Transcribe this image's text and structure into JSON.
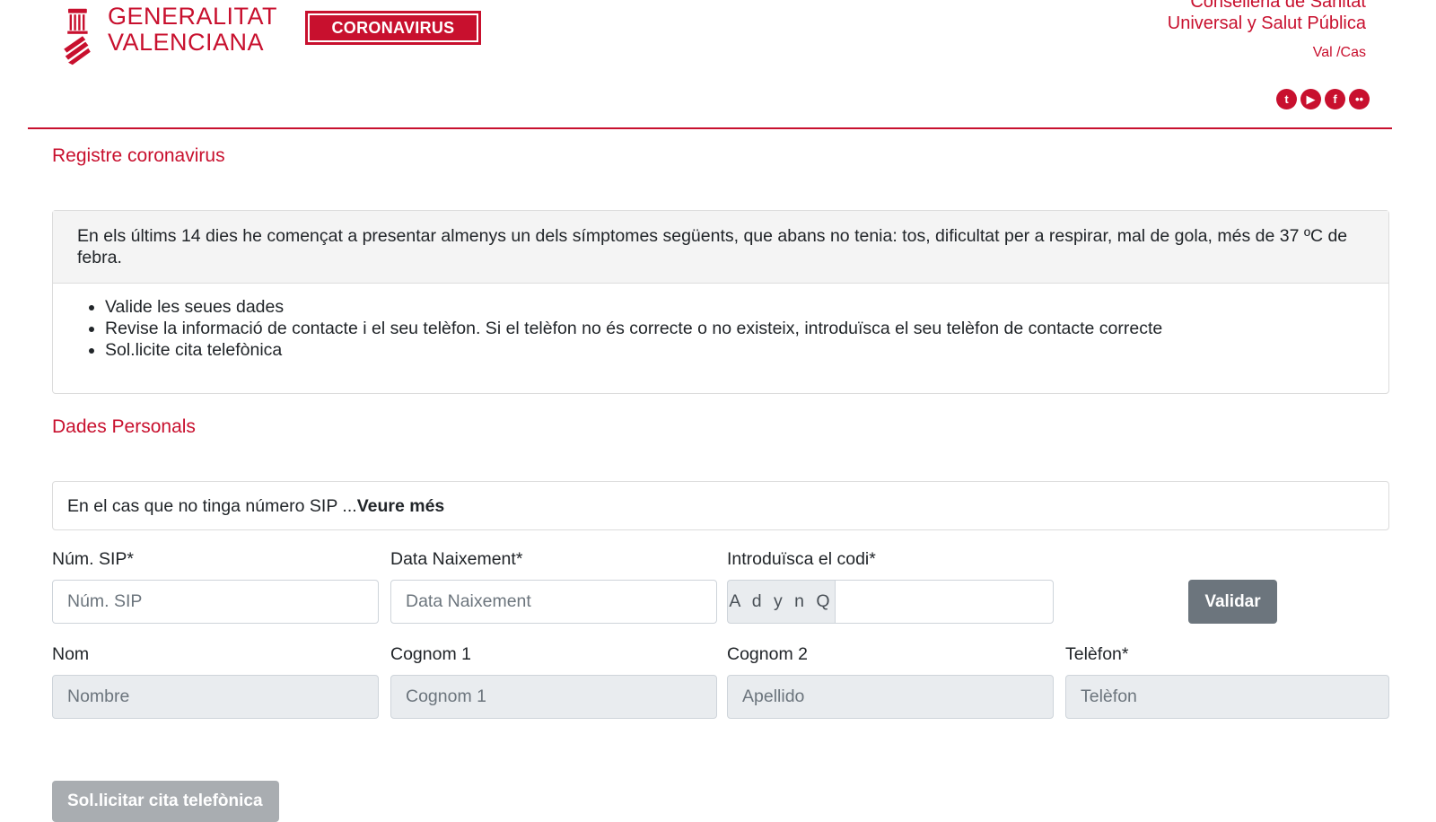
{
  "header": {
    "logo_line1": "GENERALITAT",
    "logo_line2": "VALENCIANA",
    "coronavirus_button": "CORONAVIRUS",
    "conselleria_line1": "Conselleria de Sanitat",
    "conselleria_line2": "Universal y Salut Pública",
    "language": "Val /Cas",
    "social_icons": [
      "twitter-icon",
      "youtube-icon",
      "facebook-icon",
      "flickr-icon"
    ],
    "brand_color": "#c8102e"
  },
  "page_title": "Registre coronavirus",
  "info_card": {
    "heading": "En els últims 14 dies he començat a presentar almenys un dels símptomes següents, que abans no tenia: tos, dificultat per a respirar, mal de gola, més de 37 ºC de febra.",
    "items": [
      "Valide les seues dades",
      "Revise la informació de contacte i el seu telèfon. Si el telèfon no és correcte o no existeix, introduïsca el seu telèfon de contacte correcte",
      "Sol.licite cita telefònica"
    ]
  },
  "section_title": "Dades Personals",
  "sip_notice": {
    "text": "En el cas que no tinga número SIP ...",
    "link": "Veure més"
  },
  "form": {
    "sip": {
      "label": "Núm. SIP*",
      "placeholder": "Núm. SIP",
      "value": ""
    },
    "birth": {
      "label": "Data Naixement*",
      "placeholder": "Data Naixement",
      "value": ""
    },
    "code": {
      "label": "Introduïsca el codi*",
      "captcha": "A d y n Q",
      "value": ""
    },
    "validate_button": "Validar",
    "nom": {
      "label": "Nom",
      "placeholder": "Nombre"
    },
    "cognom1": {
      "label": "Cognom 1",
      "placeholder": "Cognom 1"
    },
    "cognom2": {
      "label": "Cognom 2",
      "placeholder": "Apellido"
    },
    "telefon": {
      "label": "Telèfon*",
      "placeholder": "Telèfon"
    },
    "submit_button": "Sol.licitar cita telefònica"
  }
}
